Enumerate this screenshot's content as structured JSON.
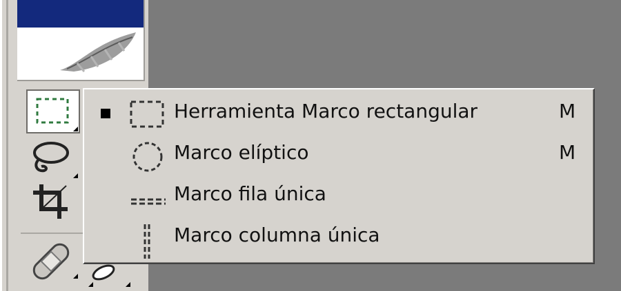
{
  "toolbox": {
    "tools": [
      {
        "name": "rectangular-marquee",
        "icon": "marquee-icon",
        "selected": true
      },
      {
        "name": "lasso",
        "icon": "lasso-icon"
      },
      {
        "name": "crop",
        "icon": "crop-icon"
      },
      {
        "name": "healing-brush",
        "icon": "bandage-icon"
      }
    ],
    "logo_icon": "feather-icon",
    "colors": {
      "panel": "#d6d3ce",
      "logo_bar": "#13297d",
      "workspace": "#7b7b7b"
    }
  },
  "flyout_menu": {
    "items": [
      {
        "label": "Herramienta Marco rectangular",
        "shortcut": "M",
        "icon": "rectangle-marquee-icon",
        "active": true
      },
      {
        "label": "Marco elíptico",
        "shortcut": "M",
        "icon": "elliptical-marquee-icon",
        "active": false
      },
      {
        "label": "Marco fila única",
        "shortcut": "",
        "icon": "single-row-marquee-icon",
        "active": false
      },
      {
        "label": "Marco columna única",
        "shortcut": "",
        "icon": "single-column-marquee-icon",
        "active": false
      }
    ]
  }
}
